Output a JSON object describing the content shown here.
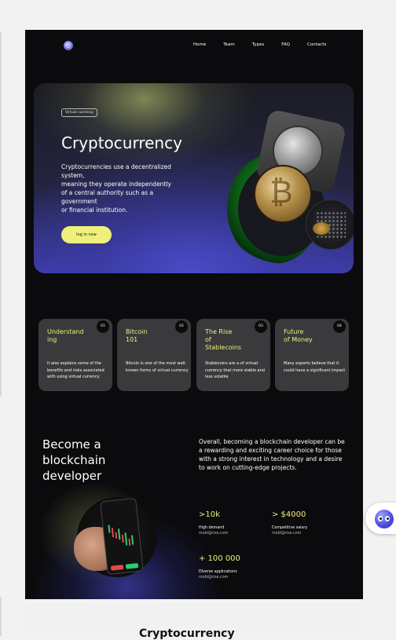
{
  "nav": {
    "links": [
      "Home",
      "Team",
      "Types",
      "FAQ",
      "Contacts"
    ]
  },
  "hero": {
    "badge": "Virtual currency",
    "title": "Cryptocurrency",
    "description_lines": [
      "Cryptocurrencies use a decentralized system,",
      "meaning they operate independently",
      "of a central authority such as a government",
      "or financial institution."
    ],
    "button": "log in now"
  },
  "cards": [
    {
      "num": "01",
      "title": "Understand\ning",
      "text": "It also explains some of the benefits and risks associated with using virtual currency"
    },
    {
      "num": "02",
      "title": "Bitcoin\n101",
      "text": "Bitcoin is one of the most well-known forms of virtual currency"
    },
    {
      "num": "03",
      "title": "The Rise\nof\nStablecoins",
      "text": "Stablecoins are a of virtual currency that more stable and less volatile"
    },
    {
      "num": "04",
      "title": "Future\nof Money",
      "text": "Many experts believe that it could have a significant impact"
    }
  ],
  "developer": {
    "title_lines": [
      "Become a",
      "blockchain",
      "developer"
    ],
    "text": "Overall, becoming a blockchain developer can be a rewarding and exciting career choice for those with a strong interest in technology and a desire to work on cutting-edge projects.",
    "stats": [
      {
        "value": ">10k",
        "label": "High demand",
        "email": "mobl@rise.com"
      },
      {
        "value": "> $4000",
        "label": "Competitive salary",
        "email": "mobl@rise.com"
      },
      {
        "value": "+ 100 000",
        "label": "Diverse applications",
        "email": "mobl@rise.com"
      }
    ]
  },
  "bottom": {
    "title": "Cryptocurrency"
  },
  "colors": {
    "accent": "#eef07a",
    "page_bg": "#0b0b0d",
    "card_bg": "#3a3a3c",
    "hero_purple": "#4a4bc6"
  }
}
